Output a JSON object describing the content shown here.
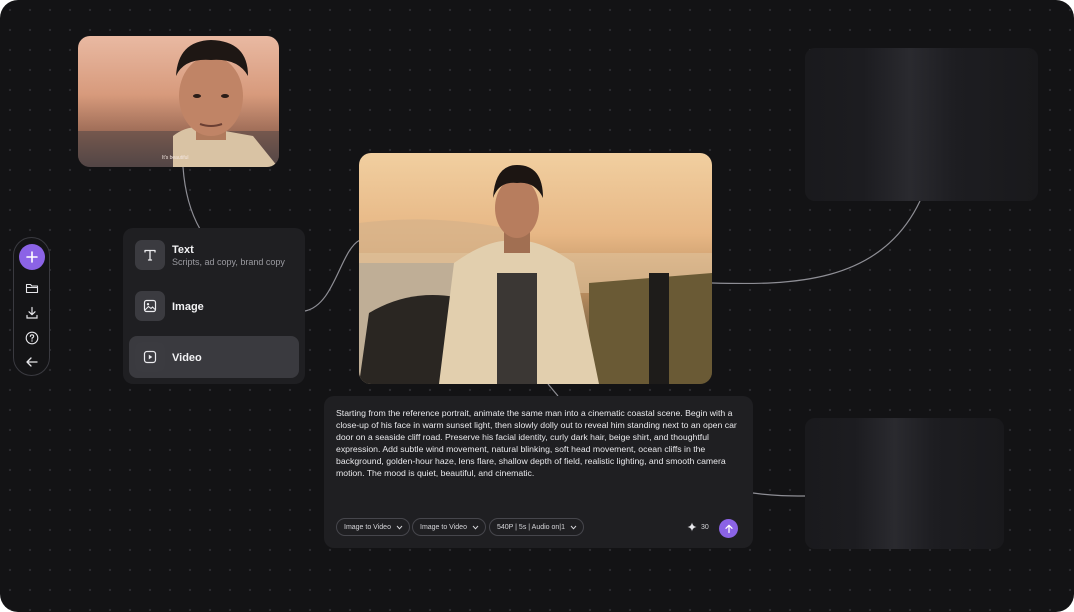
{
  "canvas": {
    "accent_color": "#8b63e6",
    "background_color": "#131315"
  },
  "toolbar": {
    "buttons": [
      {
        "name": "add",
        "icon": "plus-icon"
      },
      {
        "name": "open",
        "icon": "folder-icon"
      },
      {
        "name": "download",
        "icon": "download-icon"
      },
      {
        "name": "help",
        "icon": "help-circle-icon"
      },
      {
        "name": "back",
        "icon": "arrow-left-icon"
      }
    ]
  },
  "reference_image": {
    "caption": "It's beautiful"
  },
  "menu": {
    "items": [
      {
        "label": "Text",
        "subtitle": "Scripts, ad copy, brand copy",
        "icon": "text-icon"
      },
      {
        "label": "Image",
        "icon": "image-icon"
      },
      {
        "label": "Video",
        "icon": "video-icon",
        "active": true
      }
    ]
  },
  "prompt": {
    "text": "Starting from the reference portrait, animate the same man into a cinematic coastal scene. Begin with a close-up of his face in warm sunset light, then slowly dolly out to reveal him standing next to an open car door on a seaside cliff road. Preserve his facial identity, curly dark hair, beige shirt, and thoughtful expression. Add subtle wind movement, natural blinking, soft head movement, ocean cliffs in the background, golden-hour haze, lens flare, shallow depth of field, realistic lighting, and smooth camera motion. The mood is quiet, beautiful, and cinematic.",
    "options": [
      "Image to Video",
      "Image to Video",
      "540P | 5s | Audio on|1"
    ],
    "credits": "30",
    "send_icon": "arrow-up-icon"
  }
}
